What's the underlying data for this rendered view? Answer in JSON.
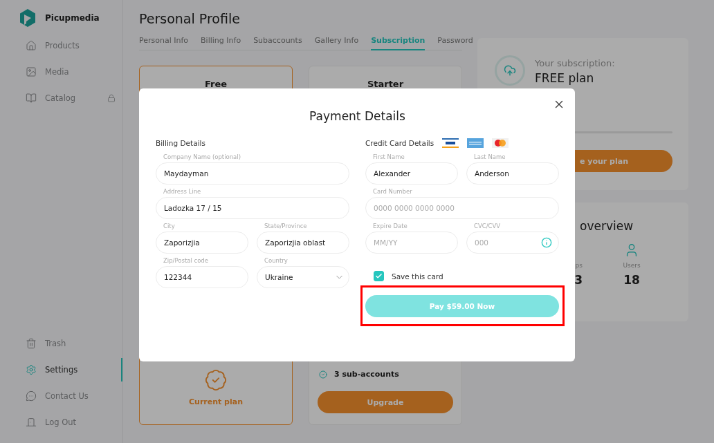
{
  "sidebar": {
    "brand": "Picupmedia",
    "items": [
      {
        "label": "Products",
        "selected": false,
        "locked": false
      },
      {
        "label": "Media",
        "selected": false,
        "locked": false
      },
      {
        "label": "Catalog",
        "selected": false,
        "locked": true
      }
    ],
    "bottom_items": [
      {
        "label": "Trash",
        "selected": false,
        "locked": false
      },
      {
        "label": "Settings",
        "selected": true,
        "locked": false
      },
      {
        "label": "Contact Us",
        "selected": false,
        "locked": false
      },
      {
        "label": "Log Out",
        "selected": false,
        "locked": false
      }
    ]
  },
  "page": {
    "title": "Personal Profile",
    "tabs": [
      {
        "label": "Personal Info",
        "selected": false
      },
      {
        "label": "Billing Info",
        "selected": false
      },
      {
        "label": "Subaccounts",
        "selected": false
      },
      {
        "label": "Gallery Info",
        "selected": false
      },
      {
        "label": "Subscription",
        "selected": true
      },
      {
        "label": "Password",
        "selected": false
      }
    ]
  },
  "plans": [
    {
      "name": "Free",
      "current": true,
      "footer": "Current plan"
    },
    {
      "name": "Starter",
      "current": false,
      "feature": "3 sub-accounts",
      "button": "Upgrade"
    }
  ],
  "subscription": {
    "heading": "Your subscription:",
    "plan": "FREE plan",
    "button": "e your plan"
  },
  "overview": {
    "title": "overview",
    "stats": [
      {
        "label": "ps",
        "value": "3"
      },
      {
        "label": "Users",
        "value": "18"
      }
    ]
  },
  "dialog": {
    "title": "Payment Details",
    "billing": {
      "heading": "Billing Details",
      "rows": [
        [
          {
            "label": "Company Name (optional)",
            "value": "Maydayman",
            "kind": "text"
          }
        ],
        [
          {
            "label": "Address Line",
            "value": "Ladozka 17 / 15",
            "kind": "text"
          }
        ],
        [
          {
            "label": "City",
            "value": "Zaporizjia",
            "kind": "text"
          },
          {
            "label": "State/Province",
            "value": "Zaporizjia oblast",
            "kind": "text"
          }
        ],
        [
          {
            "label": "Zip/Postal code",
            "value": "122344",
            "kind": "text"
          },
          {
            "label": "Country",
            "value": "Ukraine",
            "kind": "select"
          }
        ]
      ]
    },
    "card": {
      "heading": "Credit Card Details",
      "rows": [
        [
          {
            "label": "First Name",
            "value": "Alexander",
            "kind": "text"
          },
          {
            "label": "Last Name",
            "value": "Anderson",
            "kind": "text"
          }
        ],
        [
          {
            "label": "Card Number",
            "placeholder": "0000 0000 0000 0000",
            "kind": "text"
          }
        ],
        [
          {
            "label": "Expire Date",
            "placeholder": "MM/YY",
            "kind": "text"
          },
          {
            "label": "CVC/CVV",
            "placeholder": "000",
            "kind": "info"
          }
        ]
      ],
      "save_card": {
        "label": "Save this card",
        "checked": true
      },
      "pay_button": {
        "label": "Pay $59.00 Now",
        "highlighted": true
      }
    }
  }
}
